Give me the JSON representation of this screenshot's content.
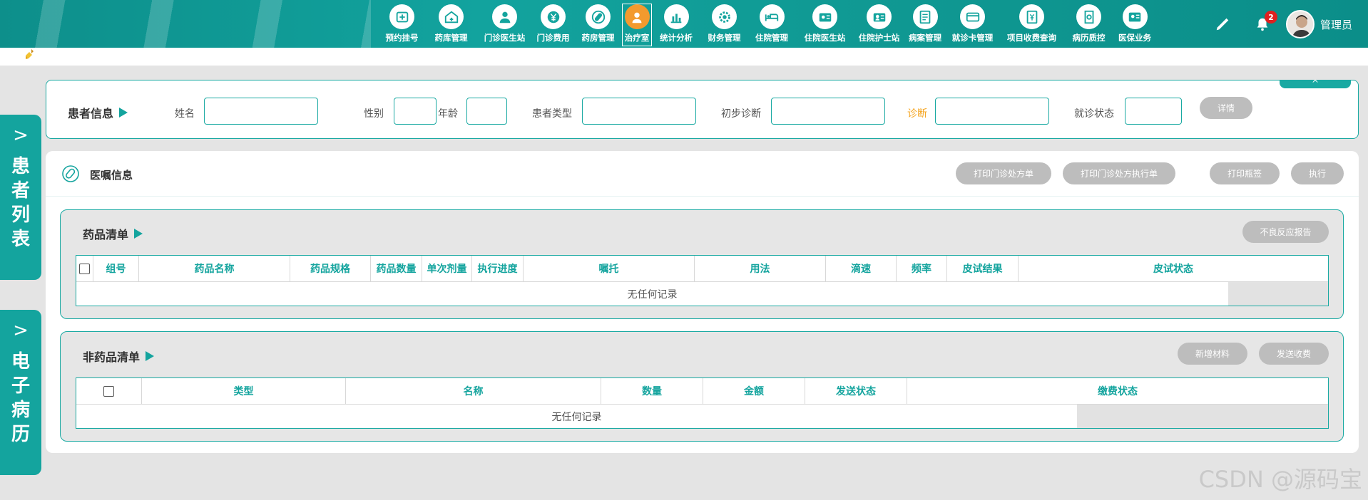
{
  "nav": [
    {
      "label": "预约挂号",
      "icon": "registration-icon"
    },
    {
      "label": "药库管理",
      "icon": "warehouse-icon"
    },
    {
      "label": "门诊医生站",
      "icon": "doctor-icon"
    },
    {
      "label": "门诊费用",
      "icon": "yuan-icon"
    },
    {
      "label": "药房管理",
      "icon": "pill-icon"
    },
    {
      "label": "治疗室",
      "icon": "nurse-icon",
      "active": true
    },
    {
      "label": "统计分析",
      "icon": "chart-icon"
    },
    {
      "label": "财务管理",
      "icon": "gear-money-icon"
    },
    {
      "label": "住院管理",
      "icon": "bed-icon"
    },
    {
      "label": "住院医生站",
      "icon": "id-card-icon"
    },
    {
      "label": "住院护士站",
      "icon": "nurse-card-icon"
    },
    {
      "label": "病案管理",
      "icon": "case-file-icon"
    },
    {
      "label": "就诊卡管理",
      "icon": "card-icon"
    },
    {
      "label": "项目收费查询",
      "icon": "fee-query-icon"
    },
    {
      "label": "病历质控",
      "icon": "quality-icon"
    },
    {
      "label": "医保业务",
      "icon": "insurance-icon"
    }
  ],
  "topbar": {
    "admin_name": "管理员",
    "notification_count": "2"
  },
  "side_tabs": {
    "patient_list": "患者列表",
    "emr": "电子病历",
    "chevron": ">"
  },
  "patient_info": {
    "title": "患者信息",
    "name_label": "姓名",
    "gender_label": "性别",
    "age_label": "年龄",
    "patient_type_label": "患者类型",
    "initial_diagnosis_label": "初步诊断",
    "diagnosis_label": "诊断",
    "visit_status_label": "就诊状态",
    "detail_button": "详情",
    "collapse_glyph": "^"
  },
  "orders": {
    "title": "医嘱信息",
    "buttons": {
      "print_prescription": "打印门诊处方单",
      "print_exec": "打印门诊处方执行单",
      "print_label": "打印瓶签",
      "execute": "执行"
    }
  },
  "drug_list": {
    "title": "药品清单",
    "adverse_report_button": "不良反应报告",
    "columns": [
      "组号",
      "药品名称",
      "药品规格",
      "药品数量",
      "单次剂量",
      "执行进度",
      "嘱托",
      "用法",
      "滴速",
      "频率",
      "皮试结果",
      "皮试状态"
    ],
    "empty_text": "无任何记录"
  },
  "non_drug_list": {
    "title": "非药品清单",
    "add_material_button": "新增材料",
    "send_charge_button": "发送收费",
    "columns": [
      "类型",
      "名称",
      "数量",
      "金额",
      "发送状态",
      "缴费状态"
    ],
    "empty_text": "无任何记录"
  },
  "watermark": "CSDN @源码宝",
  "colors": {
    "teal": "#14a49e",
    "active_orange": "#f39a2e",
    "diagnosis_label": "#f5a623",
    "badge_red": "#e02020"
  }
}
